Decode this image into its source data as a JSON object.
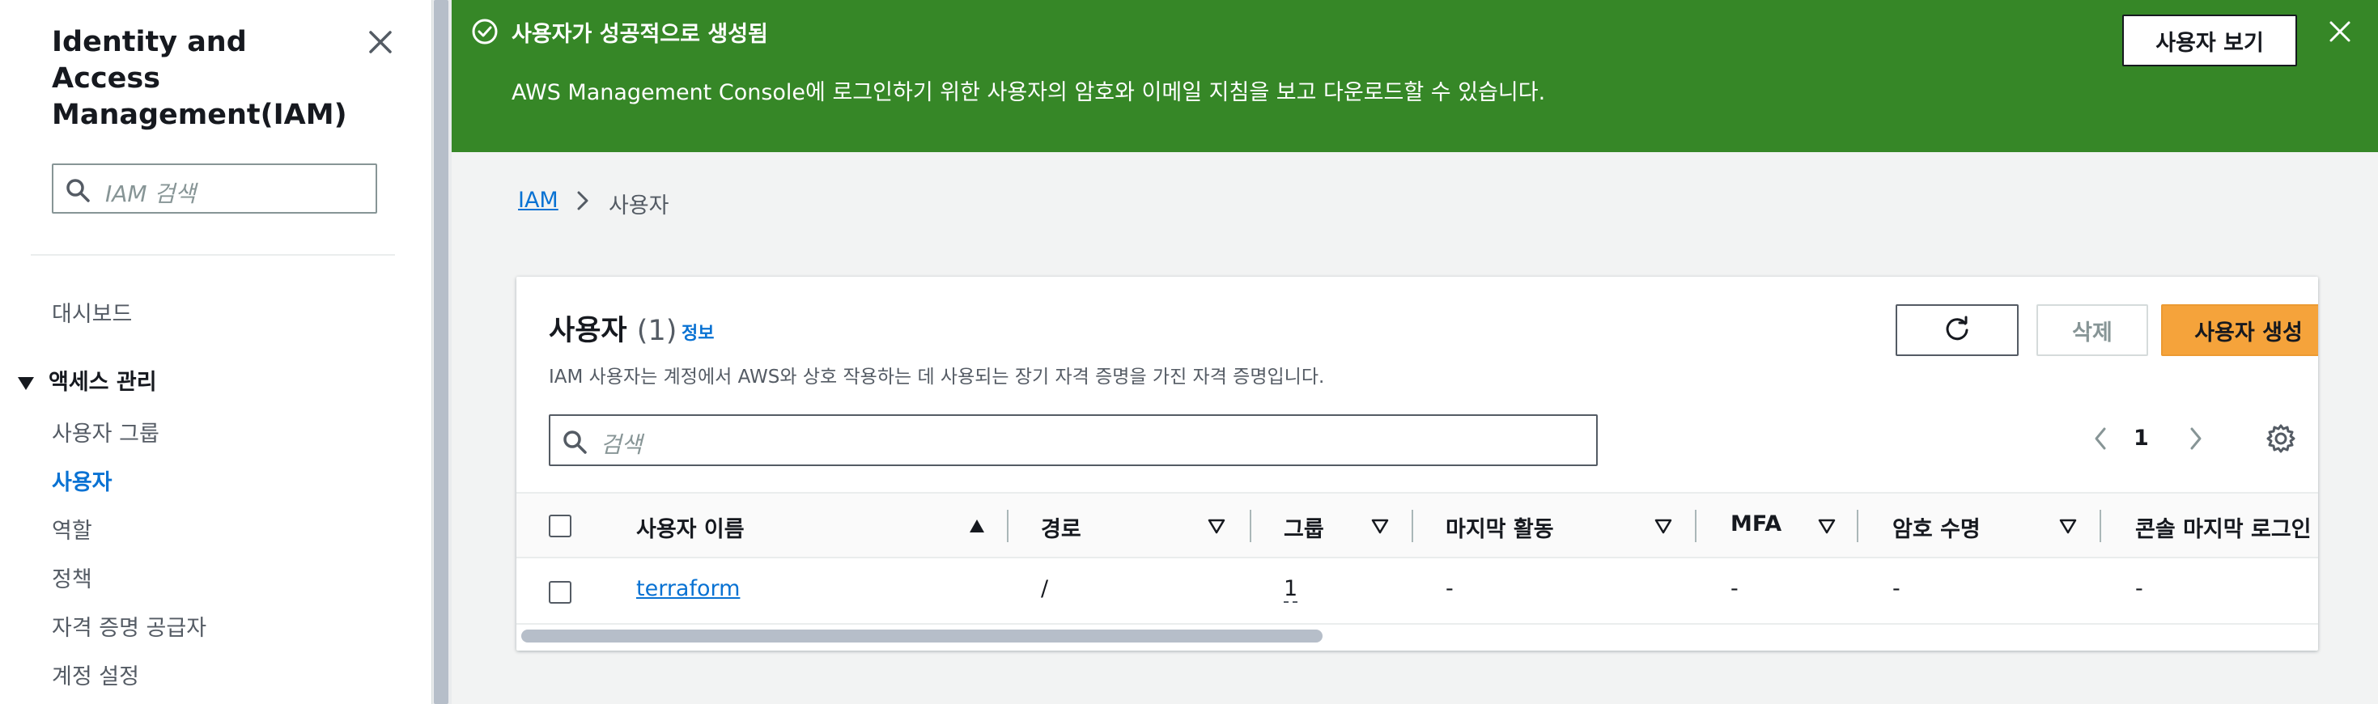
{
  "sidebar": {
    "title": "Identity and Access Management(IAM)",
    "search_placeholder": "IAM 검색",
    "dashboard": "대시보드",
    "section_access": "액세스 관리",
    "items": [
      {
        "label": "사용자 그룹",
        "active": false
      },
      {
        "label": "사용자",
        "active": true
      },
      {
        "label": "역할",
        "active": false
      },
      {
        "label": "정책",
        "active": false
      },
      {
        "label": "자격 증명 공급자",
        "active": false
      },
      {
        "label": "계정 설정",
        "active": false
      }
    ]
  },
  "banner": {
    "title": "사용자가 성공적으로 생성됨",
    "description": "AWS Management Console에 로그인하기 위한 사용자의 암호와 이메일 지침을 보고 다운로드할 수 있습니다.",
    "view_button": "사용자 보기",
    "color": "#368727"
  },
  "breadcrumb": {
    "root": "IAM",
    "current": "사용자"
  },
  "users_panel": {
    "title": "사용자",
    "count": "(1)",
    "info_link": "정보",
    "description": "IAM 사용자는 계정에서 AWS와 상호 작용하는 데 사용되는 장기 자격 증명을 가진 자격 증명입니다.",
    "delete_button": "삭제",
    "create_button": "사용자 생성",
    "search_placeholder": "검색",
    "page": "1"
  },
  "table": {
    "columns": [
      "사용자 이름",
      "경로",
      "그룹",
      "마지막 활동",
      "MFA",
      "암호 수명",
      "콘솔 마지막 로그인"
    ],
    "rows": [
      {
        "name": "terraform",
        "path": "/",
        "groups": "1",
        "last_activity": "-",
        "mfa": "-",
        "password_age": "-",
        "console_last_login": "-"
      }
    ]
  },
  "colors": {
    "accent": "#0972d3",
    "primary_button": "#f5a33b",
    "success": "#368727"
  }
}
